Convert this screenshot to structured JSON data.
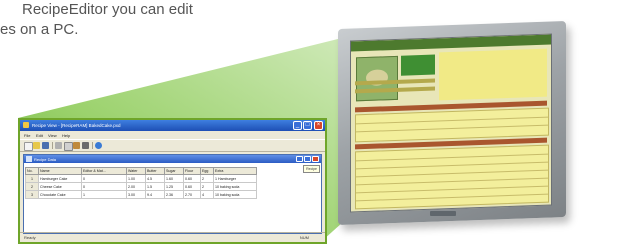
{
  "headline": {
    "line1": "RecipeEditor you can edit",
    "line2": "es on a PC."
  },
  "colors": {
    "wedge": "#79c23a",
    "window_border": "#6fa52a",
    "titlebar": "#1e4fb5"
  },
  "editor": {
    "title": "Recipe View - [RecipeRAM] BakedCake.pxd",
    "menu": [
      "File",
      "Edit",
      "View",
      "Help"
    ],
    "toolbar_icons": [
      "new-icon",
      "open-icon",
      "save-icon",
      "cut-icon",
      "copy-icon",
      "paste-icon",
      "print-icon",
      "help-icon"
    ],
    "child_window": {
      "title": "Recipe Data",
      "tooltip": "Recipe"
    },
    "table": {
      "columns": [
        "No.",
        "Name",
        "Editor & Mat...",
        "Water",
        "Butter",
        "Sugar",
        "Flour",
        "Egg",
        "Extra"
      ],
      "rows": [
        [
          "1",
          "Hamburger Cake",
          "0",
          "1.00",
          "4.5",
          "1.60",
          "0.60",
          "2",
          "1 Hamburger"
        ],
        [
          "2",
          "Cheese Cake",
          "0",
          "2.00",
          "1.5",
          "1.25",
          "0.60",
          "2",
          "10 baking soda"
        ],
        [
          "3",
          "Chocolate Cake",
          "1",
          "3.00",
          "9.4",
          "2.36",
          "2.70",
          "4",
          "10 baking soda"
        ]
      ]
    },
    "status_left": "Ready",
    "status_right": "NUM"
  }
}
